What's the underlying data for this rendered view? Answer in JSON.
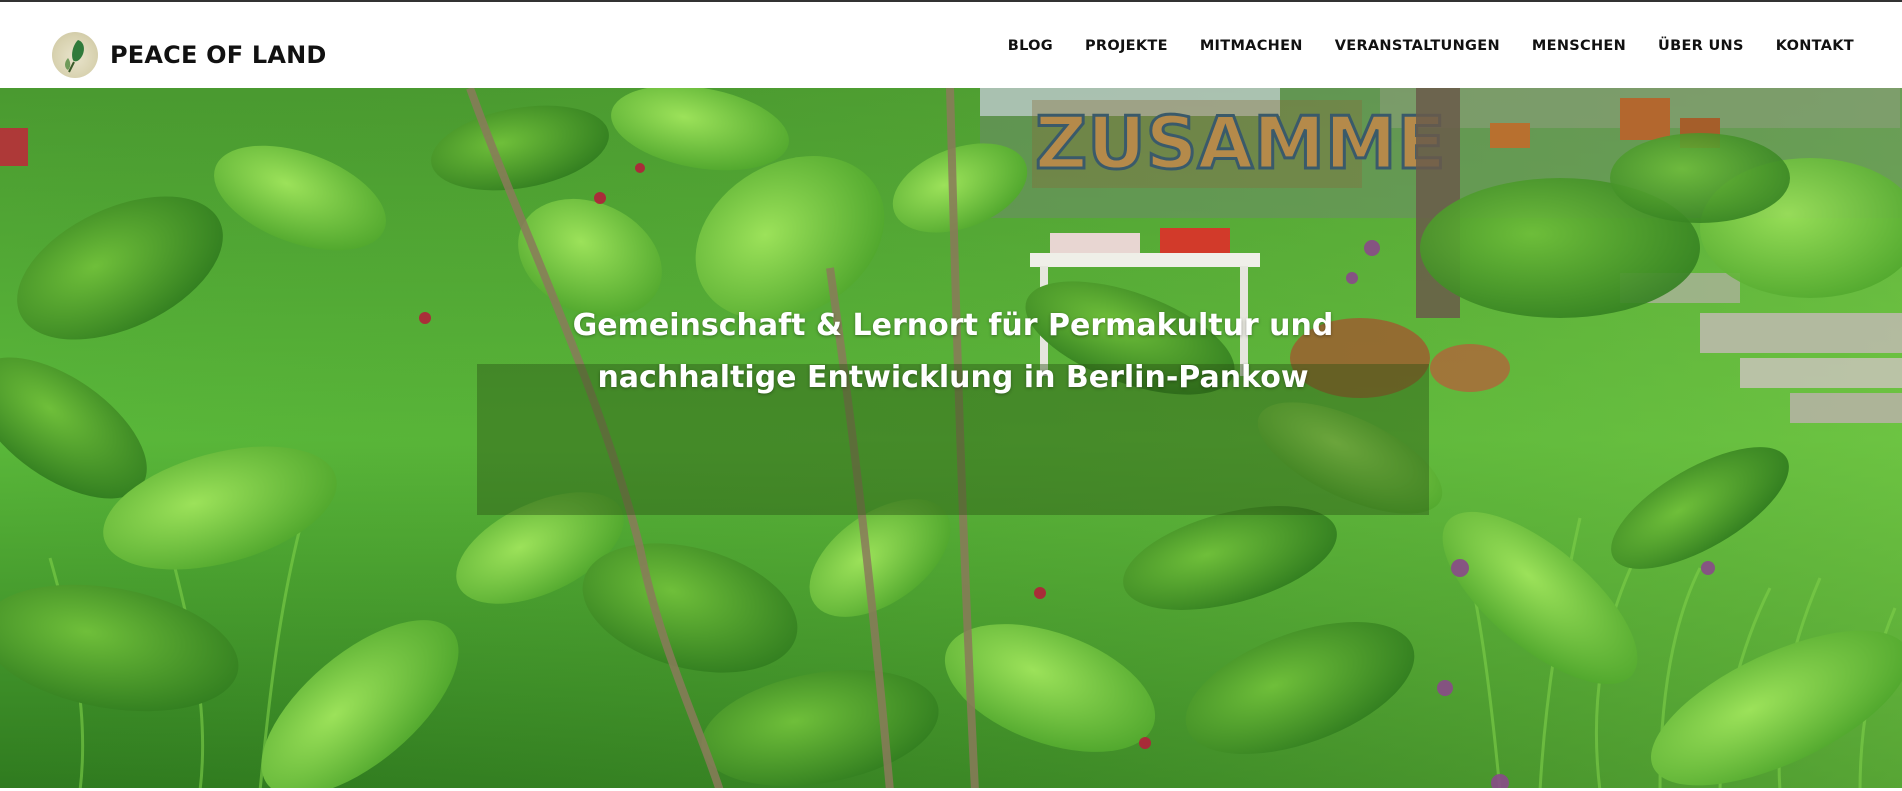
{
  "site": {
    "brand_name": "PEACE OF LAND"
  },
  "nav": {
    "items": [
      "BLOG",
      "PROJEKTE",
      "MITMACHEN",
      "VERANSTALTUNGEN",
      "MENSCHEN",
      "ÜBER UNS",
      "KONTAKT"
    ]
  },
  "hero": {
    "headline_line1": "Gemeinschaft & Lernort für Permakultur und",
    "headline_line2": "nachhaltige Entwicklung in Berlin-Pankow",
    "sign_text": "ZUSAMME"
  },
  "colors": {
    "foliage": "#3f9a2a",
    "header_bg": "#ffffff",
    "text": "#111111",
    "headline_text": "#ffffff"
  },
  "icons": [
    "logo-leaf-icon"
  ]
}
